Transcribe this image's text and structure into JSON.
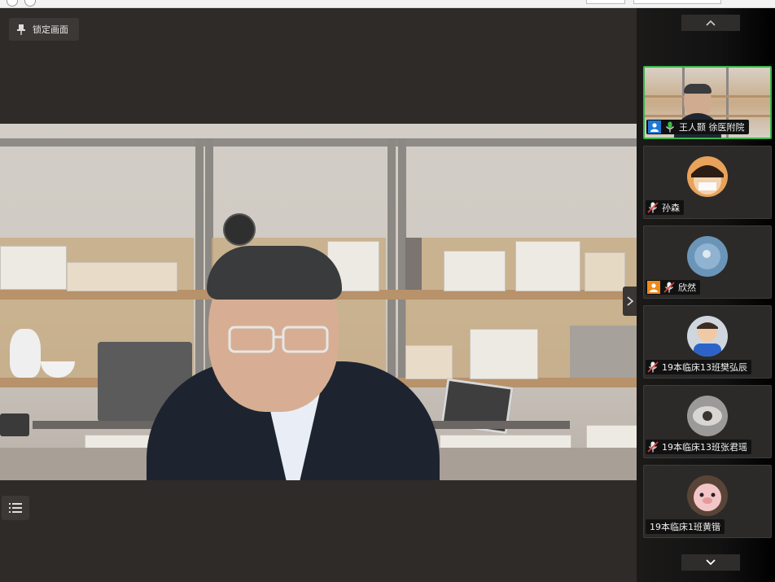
{
  "toolbar": {
    "lock_view_label": "锁定画面"
  },
  "participants": [
    {
      "name": "王人颢  徐医附院",
      "mic": "on",
      "role": "host",
      "role_color": "#1f78d6",
      "active": true
    },
    {
      "name": "孙森",
      "mic": "muted",
      "role": null
    },
    {
      "name": "欣然",
      "mic": "muted",
      "role": "attendee",
      "role_color": "#ef8a18"
    },
    {
      "name": "19本临床13班樊弘辰",
      "mic": "muted",
      "role": null
    },
    {
      "name": "19本临床13班张君瑶",
      "mic": "muted",
      "role": null
    },
    {
      "name": "19本临床1班黄锴",
      "mic": "none",
      "role": null
    }
  ],
  "icons": {
    "lock": "pin-icon",
    "list": "list-icon",
    "scroll_up": "chevron-up-icon",
    "scroll_down": "chevron-down-icon",
    "collapse": "chevron-right-icon"
  },
  "colors": {
    "active_border": "#3db34b",
    "stage_bg": "#2f2b28"
  }
}
